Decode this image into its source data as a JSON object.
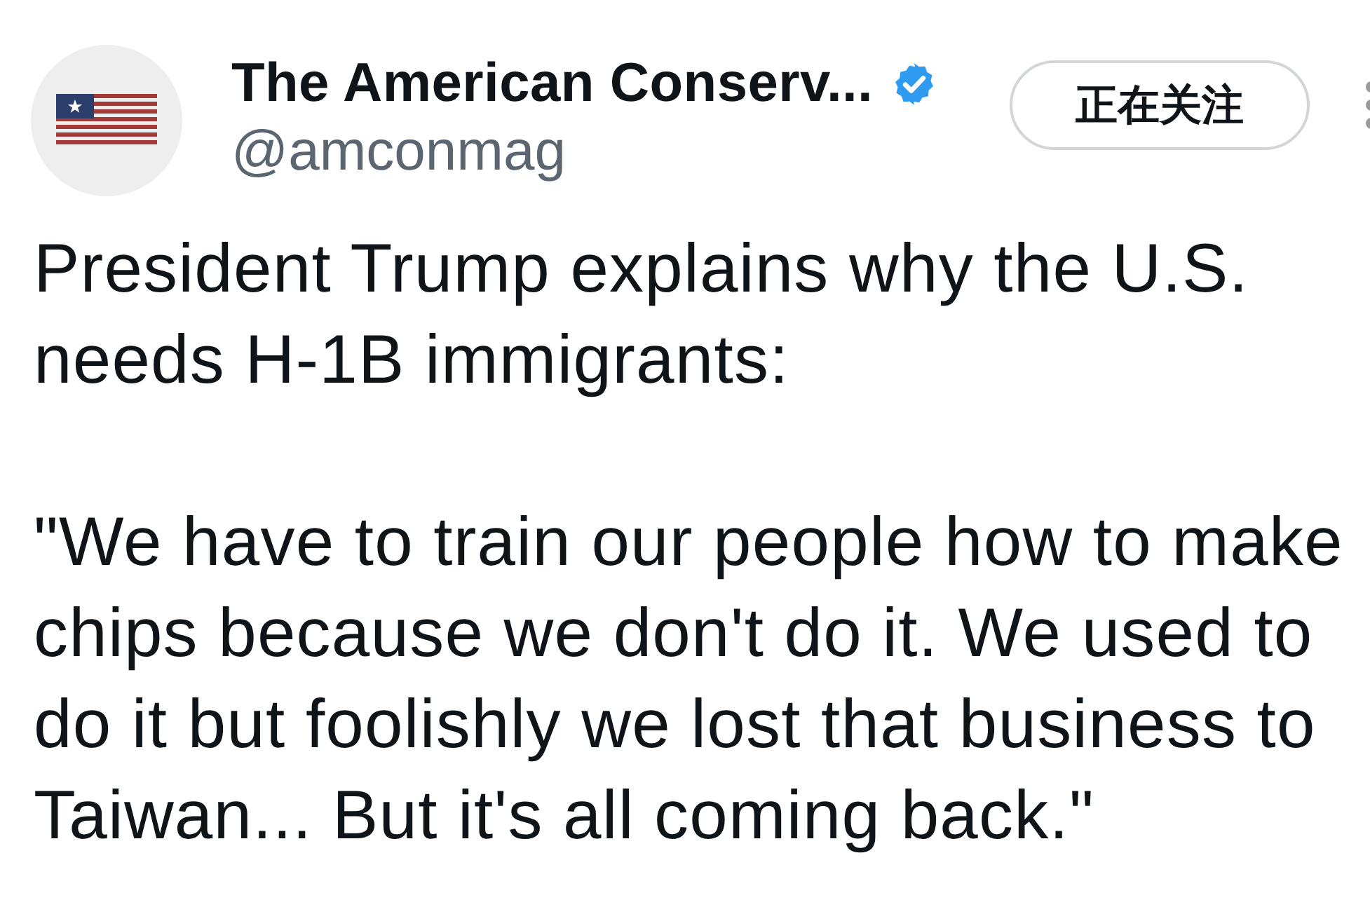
{
  "account": {
    "name": "The American Conserv...",
    "verified": true,
    "handle": "@amconmag"
  },
  "follow_button": {
    "label": "正在关注"
  },
  "post": {
    "paragraphs": [
      "President Trump explains why the U.S. needs H-1B immigrants:",
      "\"We have to train our people how to make chips because we don't do it. We used to do it but foolishly we lost that business to Taiwan... But it's all coming back.\""
    ]
  }
}
